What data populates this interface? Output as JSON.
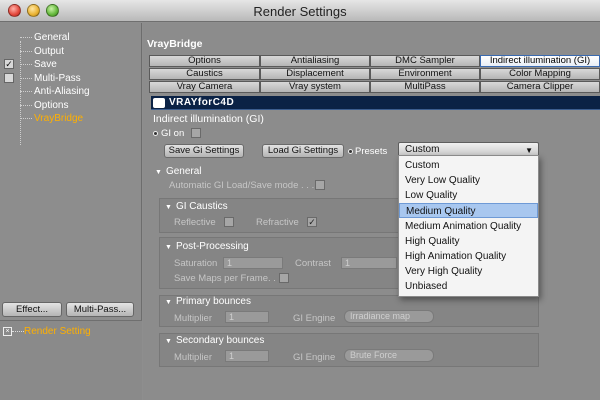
{
  "window": {
    "title": "Render Settings"
  },
  "sidebar": {
    "items": [
      {
        "label": "General",
        "checked": ""
      },
      {
        "label": "Output",
        "checked": ""
      },
      {
        "label": "Save",
        "checked": "✓"
      },
      {
        "label": "Multi-Pass",
        "checked": ""
      },
      {
        "label": "Anti-Aliasing",
        "checked": ""
      },
      {
        "label": "Options",
        "checked": ""
      },
      {
        "label": "VrayBridge",
        "checked": ""
      }
    ],
    "effect_button": "Effect...",
    "multipass_button": "Multi-Pass...",
    "render_setting": "Render Setting"
  },
  "main": {
    "panel_title": "VrayBridge",
    "tabs": [
      "Options",
      "Antialiasing",
      "DMC Sampler",
      "Indirect illumination (GI)",
      "Caustics",
      "Displacement",
      "Environment",
      "Color Mapping",
      "Vray Camera",
      "Vray system",
      "MultiPass",
      "Camera Clipper"
    ],
    "banner": "VRAYforC4D",
    "section_title": "Indirect illumination (GI)",
    "gi_on": "GI on",
    "save_button": "Save Gi Settings",
    "load_button": "Load Gi Settings",
    "presets_label": "Presets",
    "presets_value": "Custom",
    "general_header": "General",
    "auto_gi_label": "Automatic GI Load/Save mode . . .",
    "gi_caustics": {
      "header": "GI Caustics",
      "reflective": "Reflective",
      "refractive": "Refractive",
      "refractive_checked": "✓"
    },
    "post_processing": {
      "header": "Post-Processing",
      "saturation": "Saturation",
      "saturation_value": "1",
      "contrast": "Contrast",
      "contrast_value": "1",
      "save_maps": "Save Maps per Frame. . ."
    },
    "primary_bounces": {
      "header": "Primary bounces",
      "multiplier": "Multiplier",
      "multiplier_value": "1",
      "gi_engine": "GI Engine",
      "gi_engine_value": "Irradiance map"
    },
    "secondary_bounces": {
      "header": "Secondary bounces",
      "multiplier": "Multiplier",
      "multiplier_value": "1",
      "gi_engine": "GI Engine",
      "gi_engine_value": "Brute Force"
    }
  },
  "presets_menu": {
    "items": [
      "Custom",
      "Very Low Quality",
      "Low Quality",
      "Medium Quality",
      "Medium Animation Quality",
      "High Quality",
      "High Animation Quality",
      "Very High Quality",
      "Unbiased"
    ],
    "highlighted_index": 3
  }
}
